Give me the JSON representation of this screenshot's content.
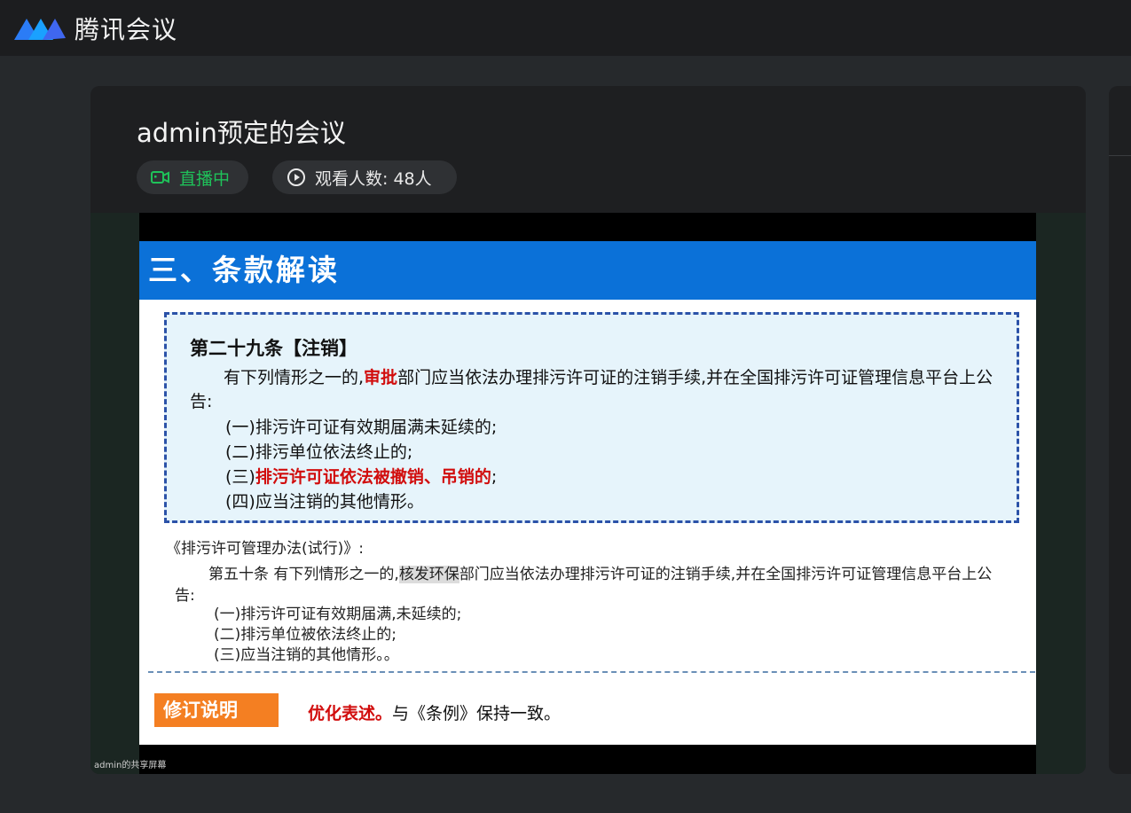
{
  "app": {
    "title": "腾讯会议"
  },
  "meeting": {
    "title": "admin预定的会议",
    "live_label": "直播中",
    "viewers_label": "观看人数: 48人"
  },
  "share": {
    "label": "admin的共享屏幕"
  },
  "slide": {
    "header": "三、条款解读",
    "article": {
      "title": "第二十九条【注销】",
      "intro_before": "有下列情形之一的,",
      "intro_highlight": "审批",
      "intro_after": "部门应当依法办理排污许可证的注销手续,并在全国排污许可证管理信息平台上公告:",
      "items": [
        {
          "text": "(一)排污许可证有效期届满未延续的;"
        },
        {
          "text": "(二)排污单位依法终止的;"
        },
        {
          "prefix": "(三)",
          "highlight": "排污许可证依法被撤销、吊销的",
          "suffix": ";"
        },
        {
          "text": "(四)应当注销的其他情形。"
        }
      ]
    },
    "reference": {
      "title": "《排污许可管理办法(试行)》:",
      "intro_before": "第五十条 有下列情形之一的,",
      "intro_highlight": "核发环保",
      "intro_after": "部门应当依法办理排污许可证的注销手续,并在全国排污许可证管理信息平台上公告:",
      "items": [
        "(一)排污许可证有效期届满,未延续的;",
        "(二)排污单位被依法终止的;",
        "(三)应当注销的其他情形。。"
      ]
    },
    "revision": {
      "label": "修订说明",
      "highlight": "优化表述。",
      "text": "与《条例》保持一致。"
    }
  },
  "colors": {
    "live_green": "#1fc25a",
    "slide_header_blue": "#0b71d8",
    "revision_orange": "#f47f22",
    "emphasis_red": "#d10d0d"
  },
  "icons": {
    "logo": "tencent-meeting-logo-icon",
    "live": "video-camera-icon",
    "viewers": "play-circle-icon"
  }
}
